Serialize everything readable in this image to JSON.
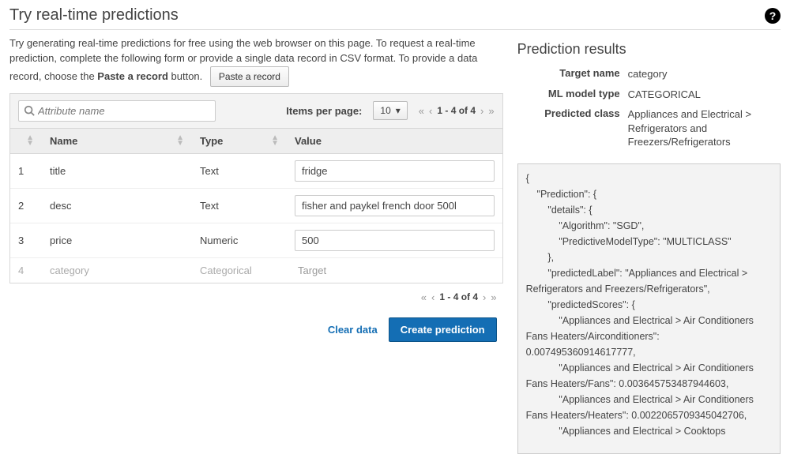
{
  "header": {
    "title": "Try real-time predictions"
  },
  "intro": {
    "line": "Try generating real-time predictions for free using the web browser on this page. To request a real-time prediction, complete the following form or provide a single data record in CSV format. To provide a data record, choose the ",
    "bold": "Paste a record",
    "tail": " button.",
    "paste_btn": "Paste a record"
  },
  "table": {
    "search_placeholder": "Attribute name",
    "items_per_page_label": "Items per page:",
    "items_per_page_value": "10",
    "page_range": "1 - 4 of 4",
    "columns": {
      "idx": "",
      "name": "Name",
      "type": "Type",
      "value": "Value"
    },
    "rows": [
      {
        "idx": "1",
        "name": "title",
        "type": "Text",
        "value": "fridge",
        "is_target": false
      },
      {
        "idx": "2",
        "name": "desc",
        "type": "Text",
        "value": "fisher and paykel french door 500l",
        "is_target": false
      },
      {
        "idx": "3",
        "name": "price",
        "type": "Numeric",
        "value": "500",
        "is_target": false
      },
      {
        "idx": "4",
        "name": "category",
        "type": "Categorical",
        "value": "Target",
        "is_target": true
      }
    ]
  },
  "actions": {
    "clear": "Clear data",
    "create": "Create prediction"
  },
  "results": {
    "title": "Prediction results",
    "target_name_label": "Target name",
    "target_name_value": "category",
    "model_type_label": "ML model type",
    "model_type_value": "CATEGORICAL",
    "predicted_class_label": "Predicted class",
    "predicted_class_value": "Appliances and Electrical > Refrigerators and Freezers/Refrigerators",
    "json_text": "{\n    \"Prediction\": {\n        \"details\": {\n            \"Algorithm\": \"SGD\",\n            \"PredictiveModelType\": \"MULTICLASS\"\n        },\n        \"predictedLabel\": \"Appliances and Electrical > Refrigerators and Freezers/Refrigerators\",\n        \"predictedScores\": {\n            \"Appliances and Electrical > Air Conditioners Fans Heaters/Airconditioners\": 0.007495360914617777,\n            \"Appliances and Electrical > Air Conditioners Fans Heaters/Fans\": 0.003645753487944603,\n            \"Appliances and Electrical > Air Conditioners Fans Heaters/Heaters\": 0.0022065709345042706,\n            \"Appliances and Electrical > Cooktops"
  }
}
